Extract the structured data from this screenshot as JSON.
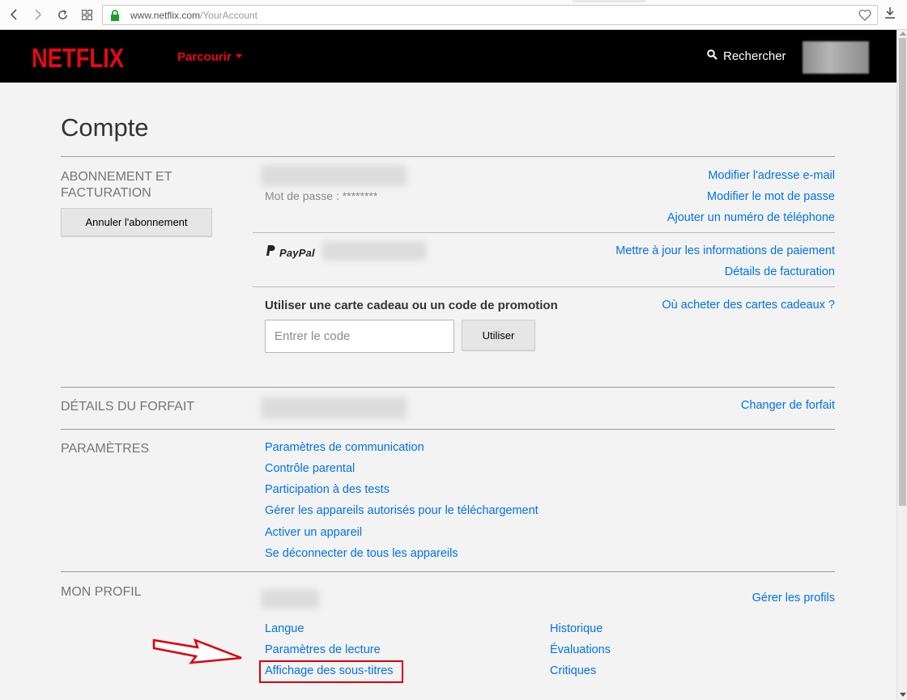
{
  "browser": {
    "url_host": "www.netflix.com",
    "url_path": "/YourAccount",
    "icons": [
      "back-icon",
      "forward-icon",
      "reload-icon",
      "grid-icon",
      "lock-icon",
      "heart-icon",
      "download-icon"
    ]
  },
  "header": {
    "logo": "NETFLIX",
    "browse_label": "Parcourir",
    "search_label": "Rechercher",
    "brand_color": "#e50914"
  },
  "page": {
    "title": "Compte"
  },
  "membership": {
    "label": "ABONNEMENT ET FACTURATION",
    "cancel_button": "Annuler l'abonnement",
    "password_text": "Mot de passe : ********",
    "links": {
      "email": "Modifier l'adresse e-mail",
      "password": "Modifier le mot de passe",
      "phone": "Ajouter un numéro de téléphone"
    },
    "payment_method": "PayPal",
    "payment_links": {
      "update": "Mettre à jour les informations de paiement",
      "billing": "Détails de facturation"
    },
    "promo": {
      "label": "Utiliser une carte cadeau ou un code de promotion",
      "placeholder": "Entrer le code",
      "button": "Utiliser",
      "where_link": "Où acheter des cartes cadeaux ?"
    }
  },
  "plan": {
    "label": "DÉTAILS DU FORFAIT",
    "change_link": "Changer de forfait"
  },
  "settings": {
    "label": "PARAMÈTRES",
    "links": [
      "Paramètres de communication",
      "Contrôle parental",
      "Participation à des tests",
      "Gérer les appareils autorisés pour le téléchargement",
      "Activer un appareil",
      "Se déconnecter de tous les appareils"
    ]
  },
  "profile": {
    "label": "MON PROFIL",
    "manage_link": "Gérer les profils",
    "left_links": [
      "Langue",
      "Paramètres de lecture",
      "Affichage des sous-titres"
    ],
    "right_links": [
      "Historique",
      "Évaluations",
      "Critiques"
    ],
    "highlight_color": "#d9000d"
  },
  "colors": {
    "link": "#0073e6",
    "label": "#757575",
    "background": "#f3f3f3"
  }
}
